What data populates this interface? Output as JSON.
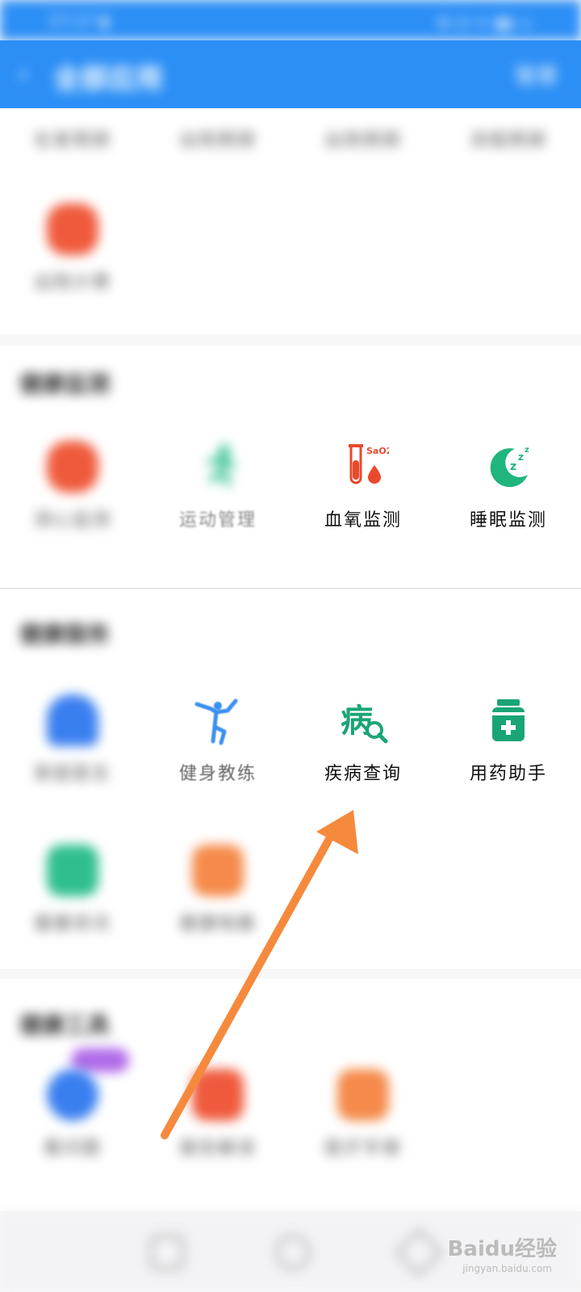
{
  "status_bar": {
    "left": "17:17 ▮",
    "right": "⚙ ⊡ ᯤ ▮▮ ▭"
  },
  "header": {
    "title": "全部应用",
    "action": "管理"
  },
  "top_row_labels": [
    "在家照顾",
    "出院照顾",
    "出院照顾",
    "流程照顾"
  ],
  "top_single": {
    "label": "出院计费"
  },
  "section_health_monitor": {
    "title": "健康监测",
    "apps": [
      {
        "label": "测心监测",
        "color": "#f05a3c"
      },
      {
        "label": "运动管理",
        "color": "#2fbf8e"
      },
      {
        "label": "血氧监测",
        "color": "#e84a2e"
      },
      {
        "label": "睡眠监测",
        "color": "#20b57d"
      }
    ]
  },
  "section_health_service": {
    "title": "健康服务",
    "apps_row1": [
      {
        "label": "家庭医生",
        "color": "#3a7ff0"
      },
      {
        "label": "健身教练",
        "color": "#3a8ff0"
      },
      {
        "label": "疾病查询",
        "color": "#1aa576"
      },
      {
        "label": "用药助手",
        "color": "#1aa576"
      }
    ],
    "apps_row2": [
      {
        "label": "健康资讯",
        "color": "#2fbf8e"
      },
      {
        "label": "健康档案",
        "color": "#f58a4a"
      }
    ]
  },
  "section_health_tools": {
    "title": "健康工具",
    "apps": [
      {
        "label": "看问题",
        "color": "#3a7ff0"
      },
      {
        "label": "报告解读",
        "color": "#f05a3c"
      },
      {
        "label": "医疗手册",
        "color": "#f58a4a"
      }
    ],
    "badge_color": "#b06ae8"
  },
  "arrow_color": "#f58a3c",
  "watermark": {
    "brand": "Baidu经验",
    "url": "jingyan.baidu.com"
  }
}
